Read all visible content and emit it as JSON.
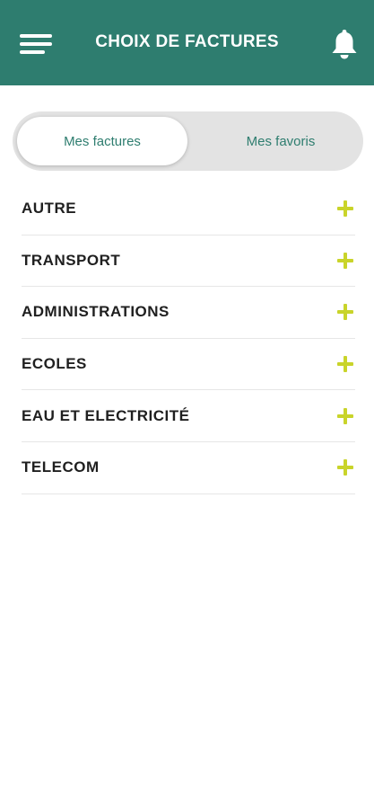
{
  "header": {
    "title": "CHOIX DE FACTURES",
    "menu_icon": "hamburger-menu-icon",
    "bell_icon": "bell-icon",
    "background_color": "#2e7d6f"
  },
  "tabs": [
    {
      "label": "Mes factures",
      "selected": true
    },
    {
      "label": "Mes favoris",
      "selected": false
    }
  ],
  "categories": [
    {
      "label": "AUTRE",
      "icon": "plus-icon"
    },
    {
      "label": "TRANSPORT",
      "icon": "plus-icon"
    },
    {
      "label": "ADMINISTRATIONS",
      "icon": "plus-icon"
    },
    {
      "label": "ECOLES",
      "icon": "plus-icon"
    },
    {
      "label": "EAU ET ELECTRICITÉ",
      "icon": "plus-icon"
    },
    {
      "label": "TELECOM",
      "icon": "plus-icon"
    }
  ],
  "colors": {
    "accent": "#2e7d6f",
    "plus": "#c9d42a"
  }
}
